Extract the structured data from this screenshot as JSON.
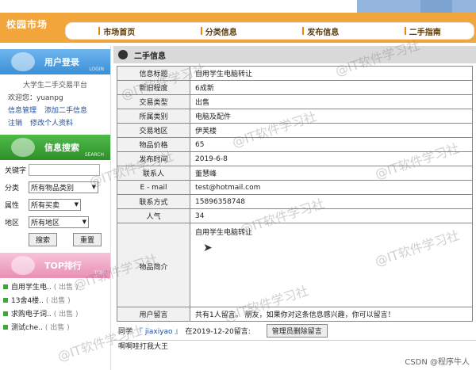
{
  "header": {
    "site_title": "校园市场",
    "nav": [
      "市场首页",
      "分类信息",
      "发布信息",
      "二手指南"
    ]
  },
  "login": {
    "title": "用户登录",
    "sub": "LOGIN",
    "site_name": "大学生二手交易平台",
    "welcome": "欢迎您：yuanpg",
    "links": [
      "信息管理",
      "添加二手信息",
      "注销",
      "修改个人资料"
    ]
  },
  "search": {
    "title": "信息搜索",
    "sub": "SEARCH",
    "keyword_label": "关键字",
    "keyword_value": "",
    "category_label": "分类",
    "category_value": "所有物品类别",
    "attr_label": "属性",
    "attr_value": "所有买卖",
    "area_label": "地区",
    "area_value": "所有地区",
    "search_btn": "搜索",
    "reset_btn": "重置"
  },
  "top": {
    "title": "TOP排行",
    "sub": "TOP",
    "items": [
      {
        "name": "自用学生电..",
        "tag": "( 出售 )"
      },
      {
        "name": "13舍4楼..",
        "tag": "( 出售 )"
      },
      {
        "name": "求购电子词..",
        "tag": "( 出售 )"
      },
      {
        "name": "测试che..",
        "tag": "( 出售 )"
      }
    ]
  },
  "main": {
    "title": "二手信息",
    "rows": [
      {
        "k": "信息标题",
        "v": "自用学生电脑转让"
      },
      {
        "k": "新旧程度",
        "v": "6成新"
      },
      {
        "k": "交易类型",
        "v": "出售"
      },
      {
        "k": "所属类别",
        "v": "电脑及配件"
      },
      {
        "k": "交易地区",
        "v": "伊芙楼"
      },
      {
        "k": "物品价格",
        "v": "65"
      },
      {
        "k": "发布时间",
        "v": "2019-6-8"
      },
      {
        "k": "联系人",
        "v": "董慧峰"
      },
      {
        "k": "E - mail",
        "v": "test@hotmail.com"
      },
      {
        "k": "联系方式",
        "v": "15896358748"
      },
      {
        "k": "人气",
        "v": "34"
      }
    ],
    "intro_label": "物品简介",
    "intro_value": "自用学生电脑转让",
    "comment_label": "用户留言",
    "comment_value": "共有1人留言。 朋友，如果你对这条信息感兴趣，你可以留言！",
    "comment_prefix": "同学",
    "comment_user": "『 jiaxiyao 』",
    "comment_time": "在2019-12-20留言:",
    "delete_btn": "管理员删除留言",
    "comment_text": "啊啊哇打我大王"
  },
  "watermark": "@IT软件学习社",
  "footer": "CSDN @程序牛人"
}
